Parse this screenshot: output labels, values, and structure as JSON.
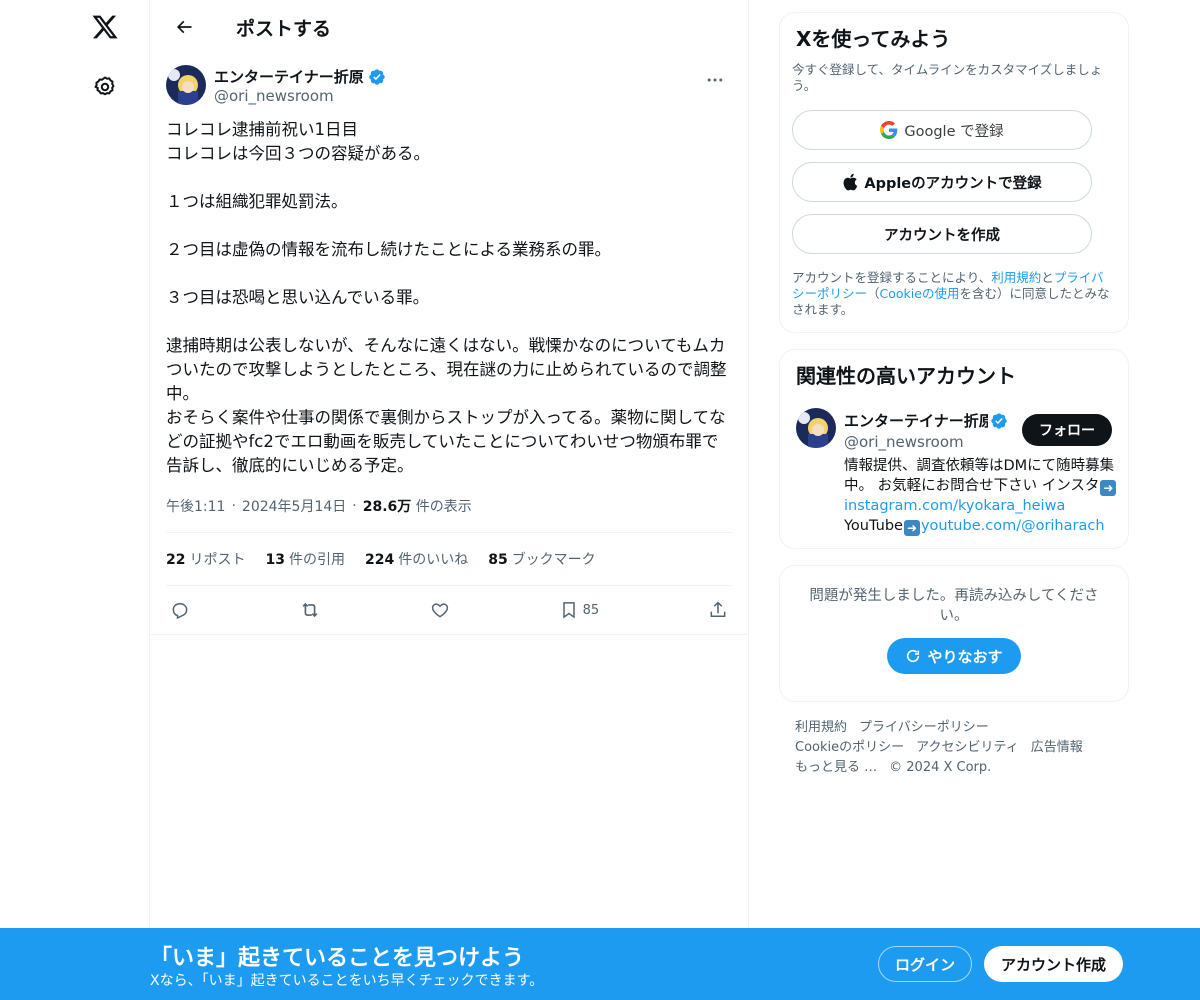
{
  "header": {
    "title": "ポストする"
  },
  "tweet": {
    "author_name": "エンターテイナー折原",
    "author_handle": "@ori_newsroom",
    "text": "コレコレ逮捕前祝い1日目\nコレコレは今回３つの容疑がある。\n\n１つは組織犯罪処罰法。\n\n２つ目は虚偽の情報を流布し続けたことによる業務系の罪。\n\n３つ目は恐喝と思い込んでいる罪。\n\n逮捕時期は公表しないが、そんなに遠くはない。戦慄かなのについてもムカついたので攻撃しようとしたところ、現在謎の力に止められているので調整中。\nおそらく案件や仕事の関係で裏側からストップが入ってる。薬物に関してなどの証拠やfc2でエロ動画を販売していたことについてわいせつ物頒布罪で告訴し、徹底的にいじめる予定。",
    "time": "午後1:11",
    "date": "2024年5月14日",
    "views_count": "28.6万",
    "views_label": "件の表示",
    "stats": {
      "reposts_count": "22",
      "reposts_label": "リポスト",
      "quotes_count": "13",
      "quotes_label": "件の引用",
      "likes_count": "224",
      "likes_label": "件のいいね",
      "bookmarks_count": "85",
      "bookmarks_label": "ブックマーク"
    },
    "bookmark_action_count": "85"
  },
  "signup_card": {
    "title": "Xを使ってみよう",
    "subtitle": "今すぐ登録して、タイムラインをカスタマイズしましょう。",
    "google_label": "Google で登録",
    "apple_label": "Appleのアカウントで登録",
    "create_label": "アカウントを作成",
    "terms_prefix": "アカウントを登録することにより、",
    "terms_link": "利用規約",
    "terms_and": "と",
    "privacy_link": "プライバシーポリシー",
    "cookie_open": "（",
    "cookie_link": "Cookieの使用",
    "cookie_rest": "を含む）に同意したとみなされます。"
  },
  "related": {
    "title": "関連性の高いアカウント",
    "name": "エンターテイナー折原",
    "handle": "@ori_newsroom",
    "follow_label": "フォロー",
    "bio_line1": "情報提供、調査依頼等はDMにて随時募集中。 お気軽にお問合せ下さい インスタ",
    "bio_link1": "instagram.com/kyokara_heiwa",
    "bio_line2": "YouTube",
    "bio_link2": "youtube.com/@oriharach"
  },
  "error_card": {
    "message": "問題が発生しました。再読み込みしてください。",
    "retry_label": "やりなおす"
  },
  "footer": {
    "terms": "利用規約",
    "privacy": "プライバシーポリシー",
    "cookie": "Cookieのポリシー",
    "accessibility": "アクセシビリティ",
    "ads": "広告情報",
    "more": "もっと見る …",
    "copyright": "© 2024 X Corp."
  },
  "bottom_bar": {
    "title": "「いま」起きていることを見つけよう",
    "subtitle": "Xなら、「いま」起きていることをいち早くチェックできます。",
    "login_label": "ログイン",
    "signup_label": "アカウント作成"
  },
  "colors": {
    "accent": "#1d9bf0",
    "text": "#0f1419",
    "muted": "#536471",
    "border": "#eff3f4"
  },
  "icons": [
    "x-logo-icon",
    "settings-icon",
    "back-arrow-icon",
    "verified-icon",
    "more-icon",
    "reply-icon",
    "repost-icon",
    "like-icon",
    "bookmark-icon",
    "share-icon",
    "google-icon",
    "apple-icon",
    "refresh-icon",
    "arrow-right-emoji-icon"
  ]
}
